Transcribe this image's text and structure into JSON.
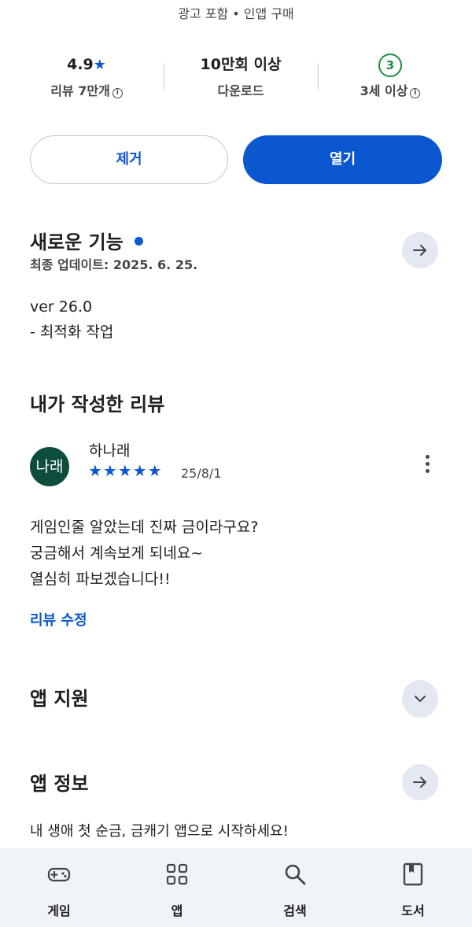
{
  "header": {
    "ads_line": "광고 포함  •  인앱 구매"
  },
  "stats": {
    "rating_value": "4.9",
    "rating_star": "★",
    "reviews_label": "리뷰 7만개",
    "downloads_value": "10만회 이상",
    "downloads_label": "다운로드",
    "age_rating": "3",
    "age_label": "3세 이상",
    "info_glyph": "i"
  },
  "actions": {
    "remove_label": "제거",
    "open_label": "열기"
  },
  "whats_new": {
    "title": "새로운 기능",
    "last_updated": "최종 업데이트: 2025. 6. 25.",
    "version": "ver 26.0",
    "note": "- 최적화 작업"
  },
  "my_review": {
    "title": "내가 작성한 리뷰",
    "avatar_text": "나래",
    "reviewer": "하나래",
    "rating": 5,
    "stars": "★★★★★",
    "date": "25/8/1",
    "lines": [
      "게임인줄 알았는데  진짜 금이라구요?",
      "궁금해서 계속보게 되네요~",
      "열심히 파보겠습니다!!"
    ],
    "edit_label": "리뷰 수정"
  },
  "app_support": {
    "title": "앱 지원"
  },
  "app_info": {
    "title": "앱 정보",
    "description": "내 생애 첫 순금, 금캐기 앱으로 시작하세요!"
  },
  "bottom_nav": {
    "items": [
      {
        "label": "게임",
        "icon": "gamepad-icon"
      },
      {
        "label": "앱",
        "icon": "apps-grid-icon"
      },
      {
        "label": "검색",
        "icon": "search-icon"
      },
      {
        "label": "도서",
        "icon": "book-icon"
      }
    ]
  },
  "colors": {
    "accent": "#0b57d0",
    "age_badge": "#1e8e3e",
    "avatar_bg": "#0d4d3d",
    "nav_bg": "#f0f4f9",
    "round_button_bg": "#e3e8f1"
  }
}
